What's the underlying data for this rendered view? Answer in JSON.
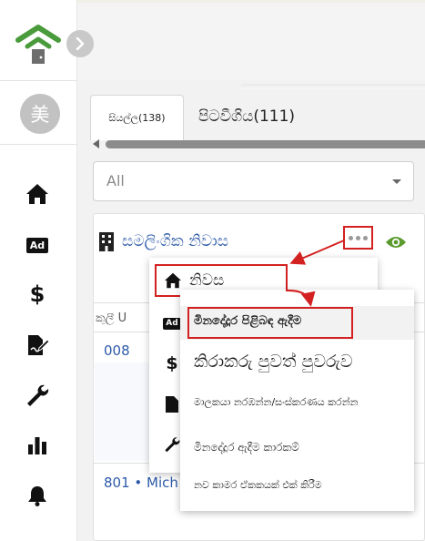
{
  "sidebar": {
    "avatar_text": "美",
    "collapse_icon": "chevron-right-icon",
    "items": [
      {
        "icon": "home-icon"
      },
      {
        "icon": "ad-icon",
        "badge": "Ad"
      },
      {
        "icon": "dollar-icon",
        "glyph": "$"
      },
      {
        "icon": "edit-document-icon"
      },
      {
        "icon": "wrench-icon"
      },
      {
        "icon": "bar-chart-icon"
      },
      {
        "icon": "bell-icon"
      }
    ]
  },
  "tabs": [
    {
      "label": "සියල්ල(138)"
    },
    {
      "label": "පිටවීගිය(111)"
    }
  ],
  "filter": {
    "value": "All"
  },
  "card": {
    "title": "සමලිංගික නිවාස",
    "more_icon": "more-dots-icon",
    "view_icon": "eye-icon",
    "column_header": "කුලී U",
    "rows": [
      {
        "id": "008"
      },
      {
        "id": "801 • Mich"
      }
    ]
  },
  "menu": {
    "label": "නිවස",
    "icon": "home-icon",
    "hidden_icons": [
      "ad-icon",
      "dollar-icon",
      "document-icon",
      "wrench-icon"
    ],
    "hidden_badge": "Ad",
    "hidden_glyph": "$"
  },
  "submenu": {
    "items": [
      {
        "label": "මිනදේදූර පිළිබඳ ඇදීම"
      },
      {
        "label": "කිරාකරු පුවත් පුවරුව"
      },
      {
        "label": "මාලකයා නරඹන්න/සංස්කරණය කරන්න"
      },
      {
        "label": "මිනදේදූර ඇදීම කාරකම්"
      },
      {
        "label": "නව කාමර ඒකකයක් එක් කිරීම"
      }
    ]
  },
  "colors": {
    "accent_red": "#d32020",
    "link_blue": "#2d5aa8",
    "logo_green": "#4a9b3c",
    "eye_green": "#5a9a2e"
  }
}
